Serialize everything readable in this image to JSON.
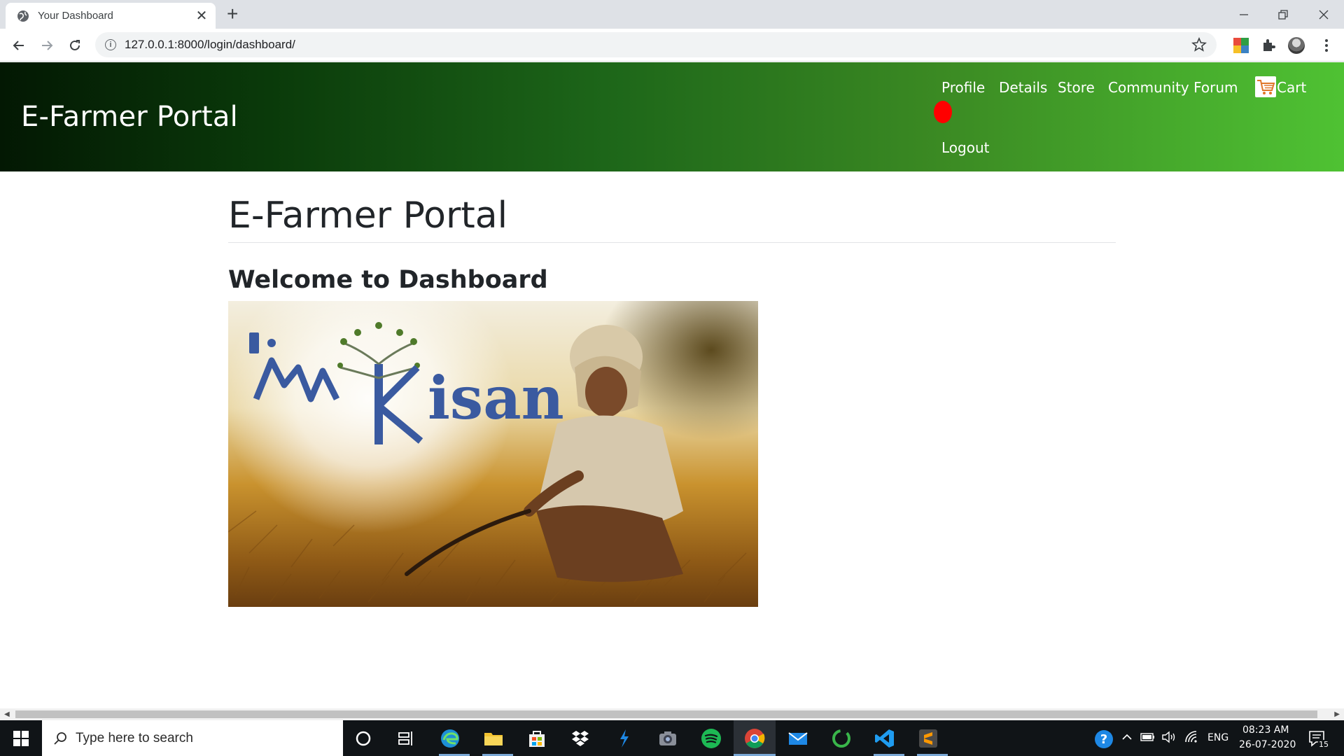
{
  "browser": {
    "tab_title": "Your Dashboard",
    "url": "127.0.0.1:8000/login/dashboard/"
  },
  "site": {
    "brand": "E-Farmer Portal",
    "nav": {
      "profile": "Profile",
      "details": "Details",
      "store": "Store",
      "community_forum": "Community Forum",
      "cart": "Cart",
      "logout": "Logout"
    }
  },
  "main": {
    "page_title": "E-Farmer Portal",
    "welcome": "Welcome to Dashboard"
  },
  "taskbar": {
    "search_placeholder": "Type here to search",
    "language": "ENG",
    "time": "08:23 AM",
    "date": "26-07-2020",
    "notifications": "15"
  },
  "colors": {
    "header_start": "#031803",
    "header_end": "#4fc233",
    "notification_dot": "#ff0000"
  }
}
